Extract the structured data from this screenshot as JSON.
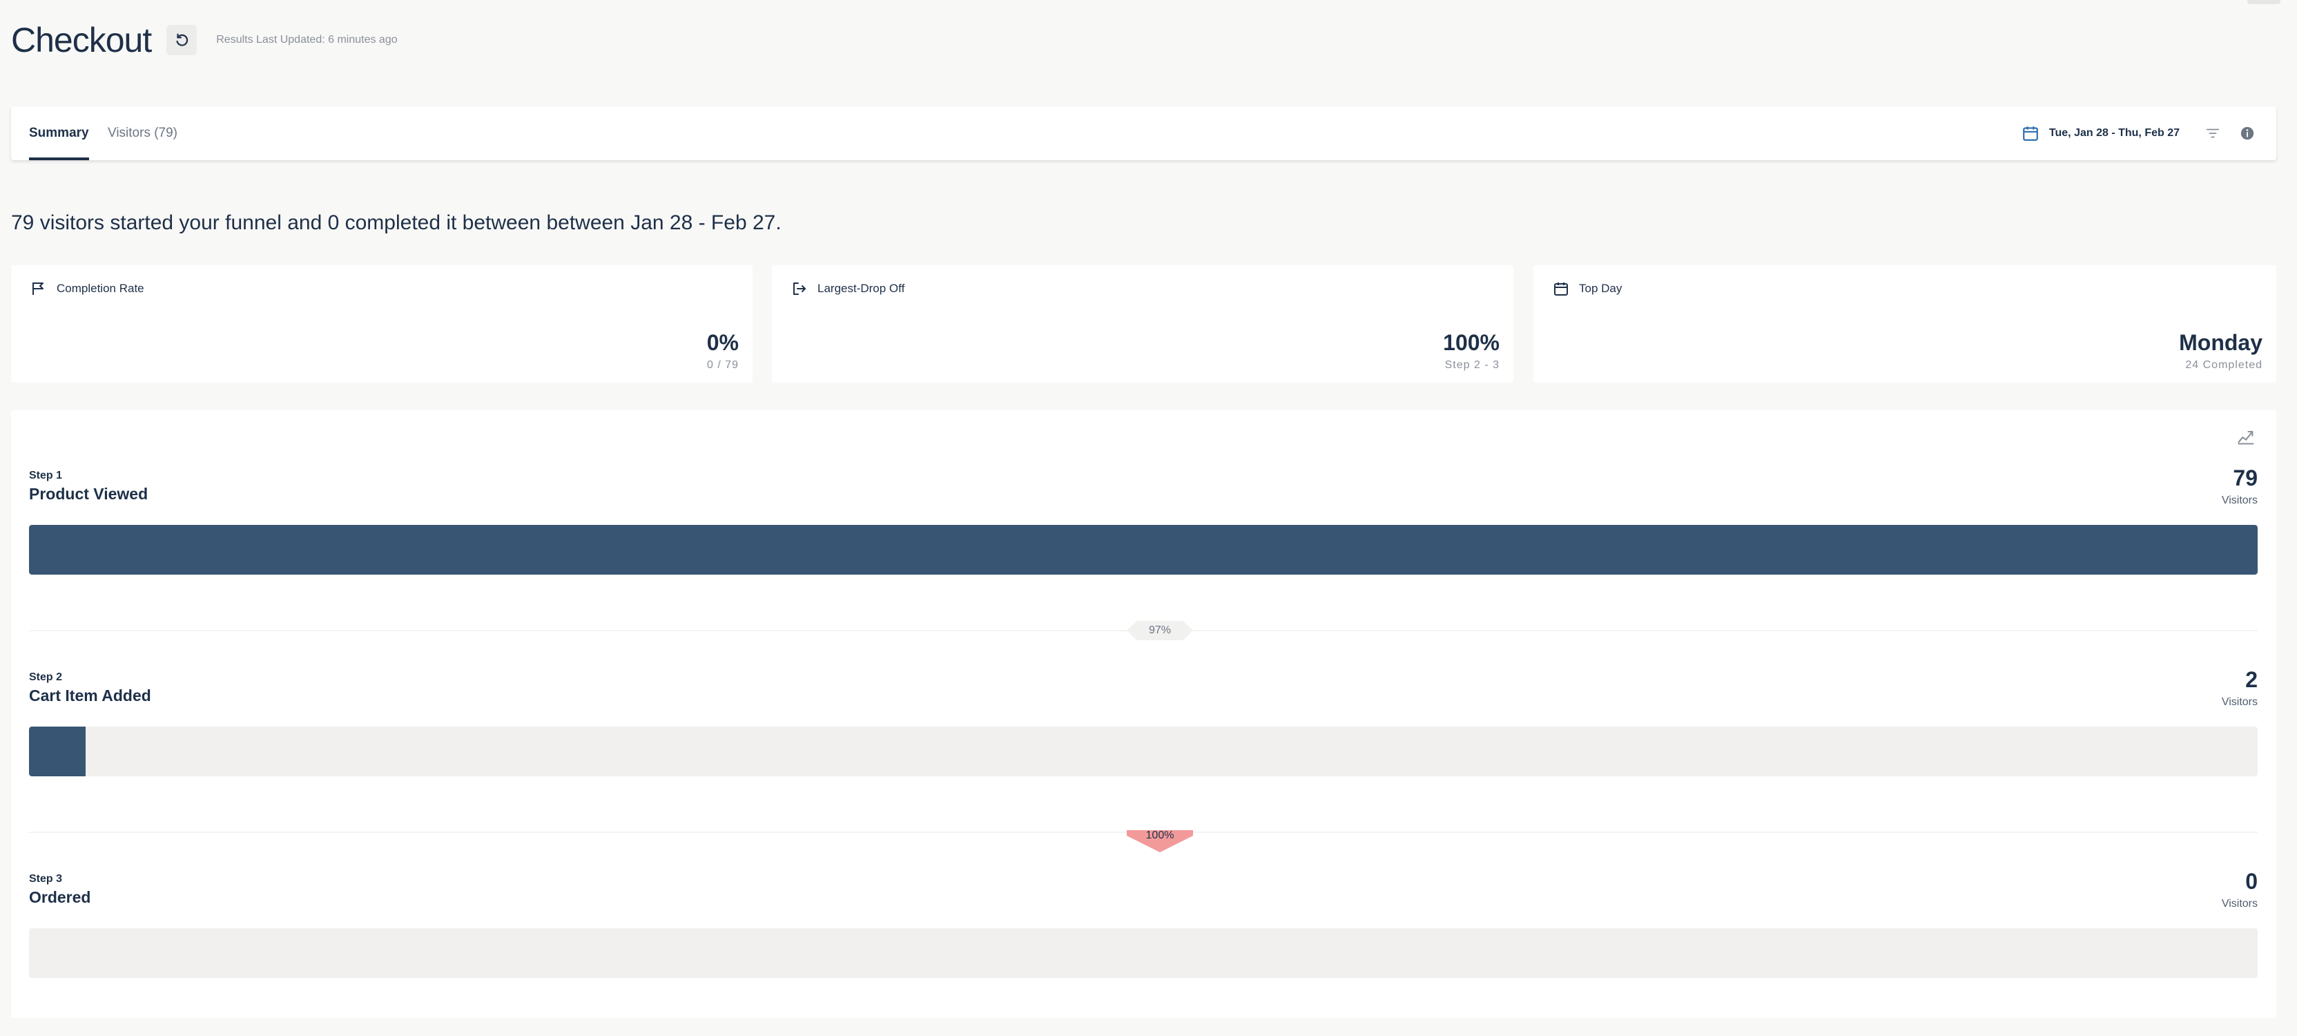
{
  "header": {
    "title": "Checkout",
    "updated": "Results Last Updated: 6 minutes ago"
  },
  "tabs": {
    "summary": "Summary",
    "visitors": "Visitors (79)",
    "date_range": "Tue, Jan 28 - Thu, Feb 27"
  },
  "summary_text": "79 visitors started your funnel and 0 completed it between between Jan 28 - Feb 27.",
  "cards": [
    {
      "label": "Completion Rate",
      "value": "0%",
      "sub": "0 / 79",
      "icon": "flag-icon"
    },
    {
      "label": "Largest-Drop Off",
      "value": "100%",
      "sub": "Step 2 - 3",
      "icon": "exit-icon"
    },
    {
      "label": "Top Day",
      "value": "Monday",
      "sub": "24 Completed",
      "icon": "calendar-icon"
    }
  ],
  "funnel": {
    "max_visitors": 79,
    "steps": [
      {
        "label": "Step 1",
        "name": "Product Viewed",
        "count": "79",
        "count_value": 79,
        "count_label": "Visitors"
      },
      {
        "label": "Step 2",
        "name": "Cart Item Added",
        "count": "2",
        "count_value": 2,
        "count_label": "Visitors"
      },
      {
        "label": "Step 3",
        "name": "Ordered",
        "count": "0",
        "count_value": 0,
        "count_label": "Visitors"
      }
    ],
    "dropoffs": [
      {
        "value": "97%",
        "severity": "low"
      },
      {
        "value": "100%",
        "severity": "high"
      }
    ]
  },
  "colors": {
    "primary": "#1e3048",
    "bar_fill": "#385673",
    "bar_track": "#f1f0ee",
    "drop_high": "#f29a99"
  }
}
